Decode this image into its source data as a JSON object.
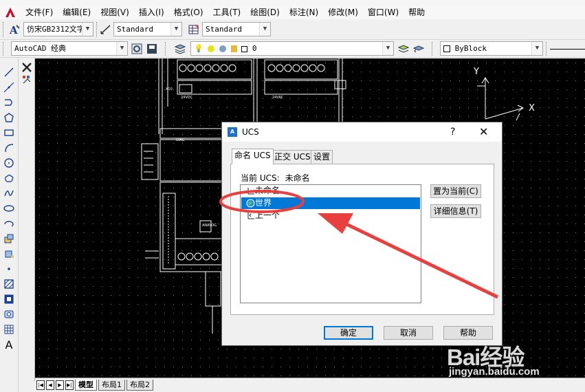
{
  "menu": {
    "items": [
      "文件(F)",
      "编辑(E)",
      "视图(V)",
      "插入(I)",
      "格式(O)",
      "工具(T)",
      "绘图(D)",
      "标注(N)",
      "修改(M)",
      "窗口(W)",
      "帮助"
    ]
  },
  "toolbar1": {
    "font": "仿宋GB2312文字",
    "dim_style": "Standard",
    "table_style": "Standard"
  },
  "toolbar2": {
    "workspace": "AutoCAD 经典",
    "layer": "0",
    "color": "ByBlock"
  },
  "layout_tabs": [
    "模型",
    "布局1",
    "布局2"
  ],
  "canvas": {
    "axis_y": "Y",
    "axis_x": "X"
  },
  "dialog": {
    "title": "UCS",
    "help_glyph": "?",
    "close_glyph": "✕",
    "tabs": [
      "命名 UCS",
      "正交 UCS",
      "设置"
    ],
    "current_label": "当前 UCS:",
    "current_value": "未命名",
    "list": [
      {
        "label": "未命名",
        "selected": false
      },
      {
        "label": "世界",
        "selected": true
      },
      {
        "label": "上一个",
        "selected": false
      }
    ],
    "side_buttons": {
      "set_current": "置为当前(C)",
      "details": "详细信息(T)"
    },
    "buttons": {
      "ok": "确定",
      "cancel": "取消",
      "help": "帮助"
    }
  },
  "watermark": {
    "text": "Bai经验",
    "url": "jingyan.baidu.com"
  },
  "colors": {
    "canvas_bg": "#000000",
    "selection": "#0078d7",
    "annotation_red": "#e8403f"
  }
}
